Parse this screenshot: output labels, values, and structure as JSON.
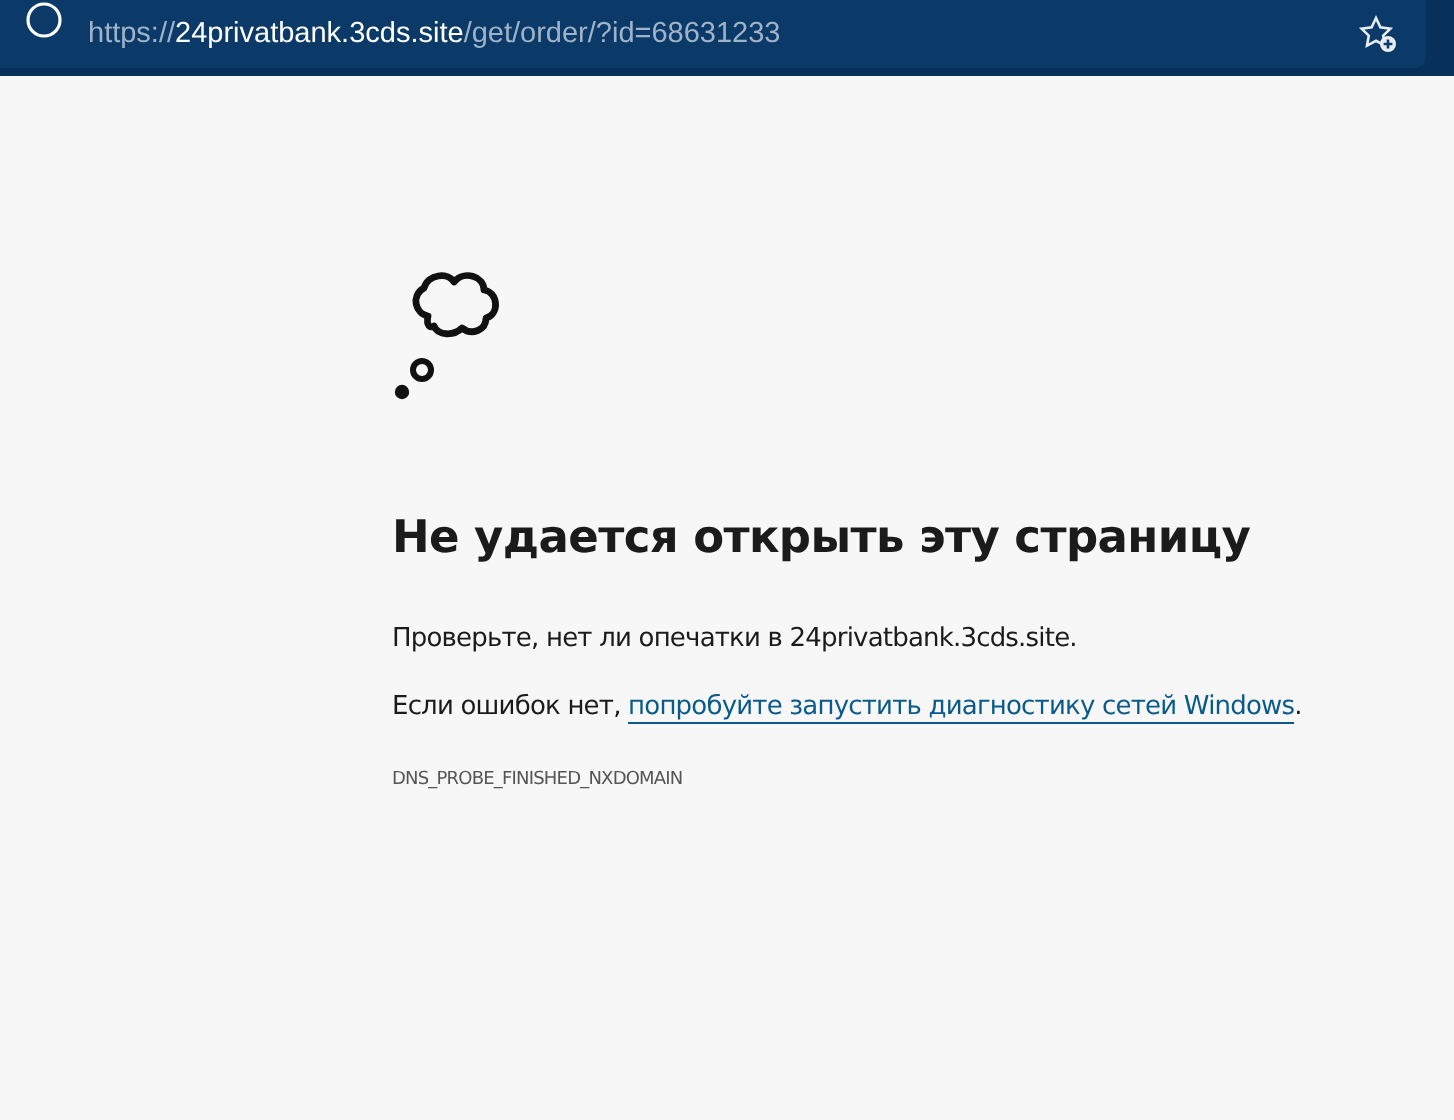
{
  "address_bar": {
    "url": "https://**24privatbank.3cds.site**/get/order/?id=68631233"
  },
  "error": {
    "title": "Не удается открыть эту страницу",
    "check_text": "Проверьте, нет ли опечатки в 24privatbank.3cds.site.",
    "hint_prefix": "Если ошибок нет,",
    "hint_link": "попробуйте запустить диагностику сетей Windows",
    "hint_suffix": ".",
    "code": "DNS_PROBE_FINISHED_NXDOMAIN"
  }
}
